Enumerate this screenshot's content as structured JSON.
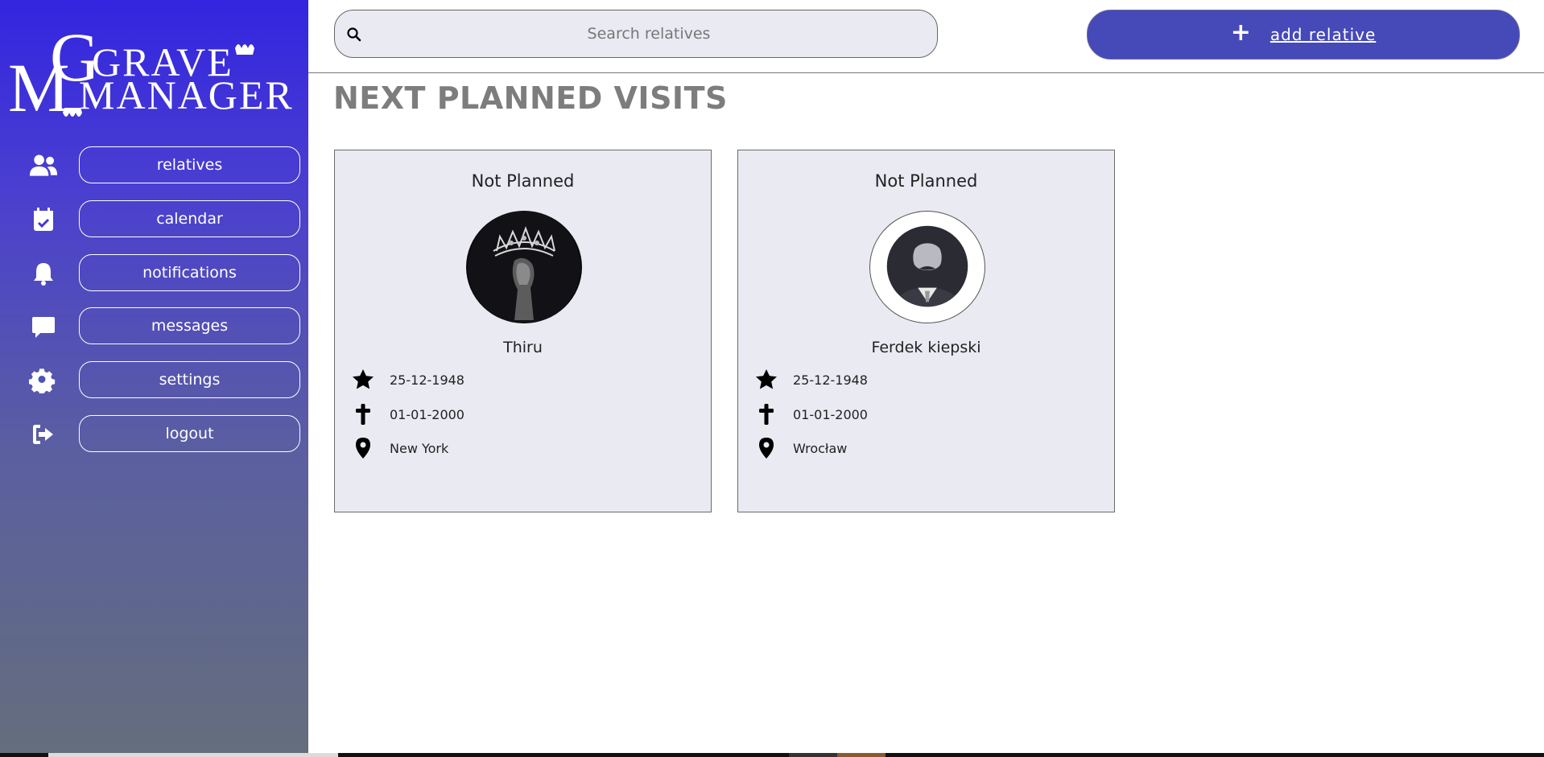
{
  "app": {
    "logo_text_top": "GRAVE",
    "logo_text_bottom": "MANAGER",
    "logo_initial_top": "G",
    "logo_initial_bottom": "M"
  },
  "sidebar": {
    "items": [
      {
        "label": "relatives",
        "icon": "users-icon"
      },
      {
        "label": "calendar",
        "icon": "calendar-check-icon"
      },
      {
        "label": "notifications",
        "icon": "bell-icon"
      },
      {
        "label": "messages",
        "icon": "message-icon"
      },
      {
        "label": "settings",
        "icon": "gear-icon"
      },
      {
        "label": "logout",
        "icon": "logout-icon"
      }
    ]
  },
  "search": {
    "placeholder": "Search relatives",
    "value": ""
  },
  "toolbar": {
    "add_label": "add relative",
    "add_icon": "+"
  },
  "main": {
    "title": "NEXT PLANNED VISITS",
    "cards": [
      {
        "status": "Not Planned",
        "name": "Thiru",
        "birth_date": "25-12-1948",
        "death_date": "01-01-2000",
        "location": "New York",
        "avatar": "dark-crown-photo"
      },
      {
        "status": "Not Planned",
        "name": "Ferdek kiepski",
        "birth_date": "25-12-1948",
        "death_date": "01-01-2000",
        "location": "Wrocław",
        "avatar": "default-man-avatar"
      }
    ]
  },
  "colors": {
    "sidebar_top": "#3325e0",
    "sidebar_bottom": "#646e7c",
    "accent": "#4649b8",
    "card_bg": "#e9eaf2",
    "title": "#7d7d7d"
  }
}
